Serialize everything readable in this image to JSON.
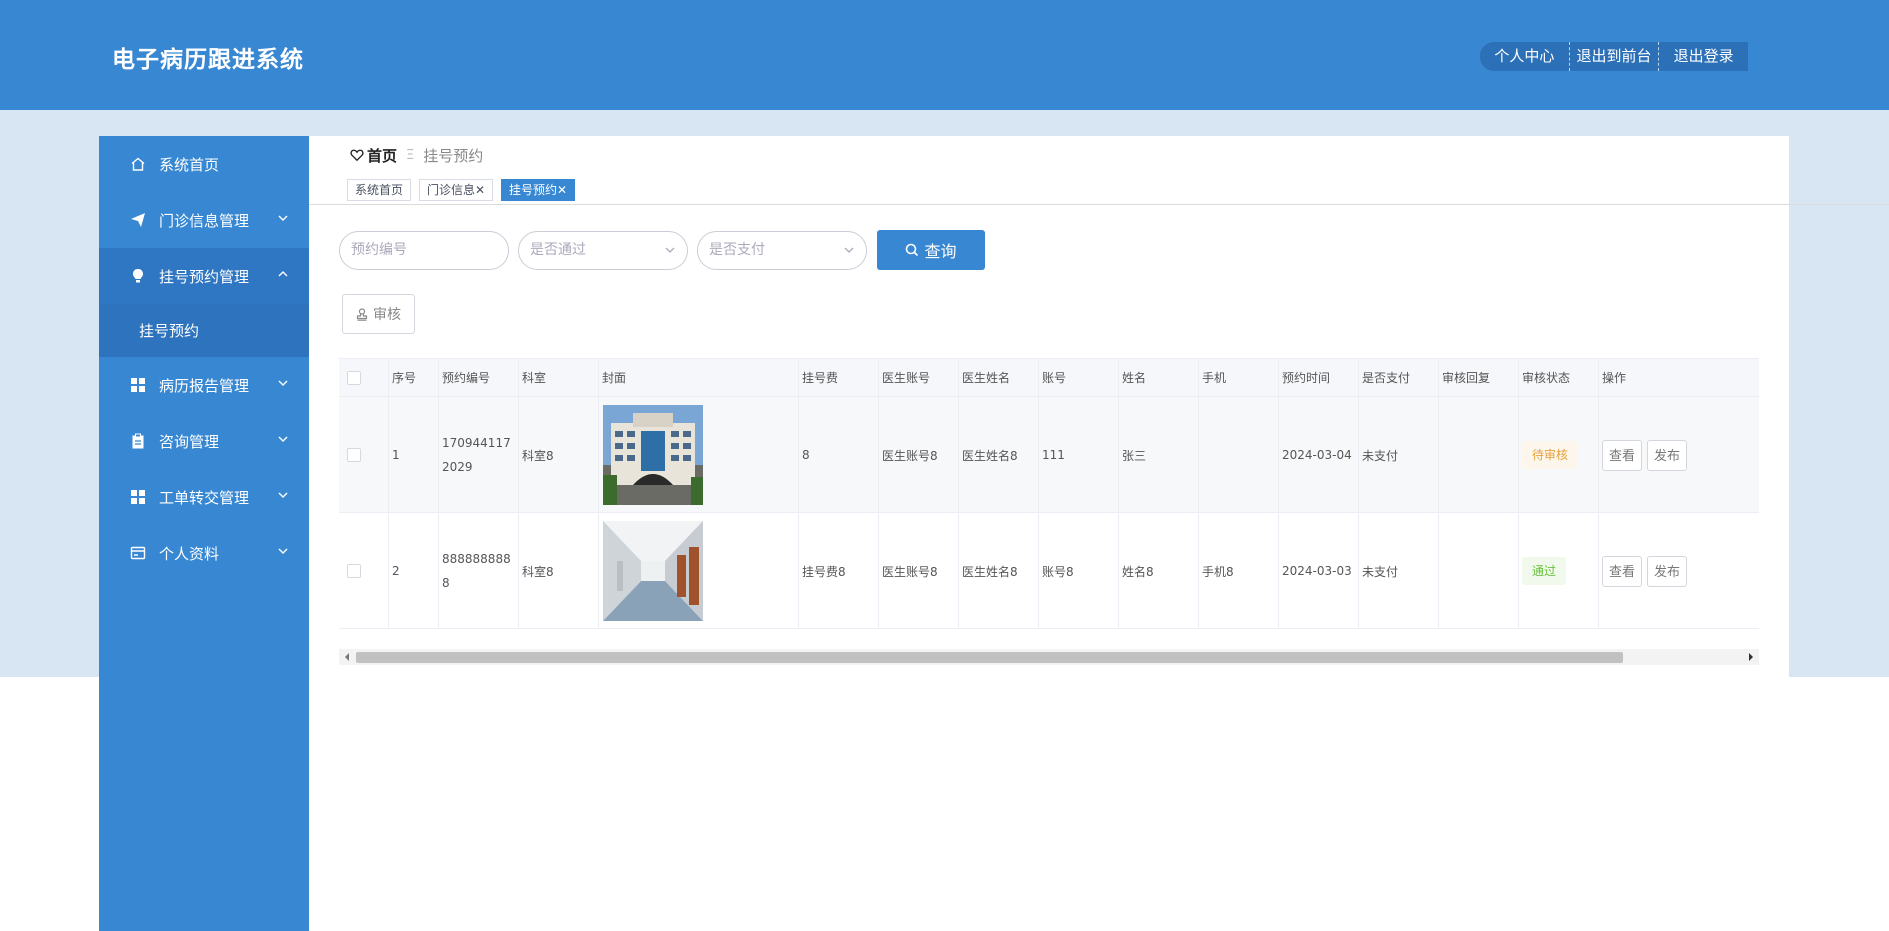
{
  "header": {
    "title": "电子病历跟进系统",
    "actions": [
      "个人中心",
      "退出到前台",
      "退出登录"
    ]
  },
  "sidebar": {
    "items": [
      {
        "label": "系统首页",
        "icon": "home-icon"
      },
      {
        "label": "门诊信息管理",
        "icon": "send-icon"
      },
      {
        "label": "挂号预约管理",
        "icon": "bulb-icon",
        "open": true
      },
      {
        "label": "病历报告管理",
        "icon": "grid-icon"
      },
      {
        "label": "咨询管理",
        "icon": "clipboard-icon"
      },
      {
        "label": "工单转交管理",
        "icon": "grid-icon"
      },
      {
        "label": "个人资料",
        "icon": "card-icon"
      }
    ],
    "sub_item": "挂号预约"
  },
  "breadcrumb": {
    "home": "首页",
    "current": "挂号预约"
  },
  "tags": [
    {
      "label": "系统首页"
    },
    {
      "label": "门诊信息",
      "closable": true
    },
    {
      "label": "挂号预约",
      "closable": true,
      "active": true
    }
  ],
  "search": {
    "booking_no_placeholder": "预约编号",
    "passed_placeholder": "是否通过",
    "paid_placeholder": "是否支付",
    "query_label": "查询"
  },
  "toolbar": {
    "audit_label": "审核"
  },
  "table": {
    "columns": [
      "序号",
      "预约编号",
      "科室",
      "封面",
      "挂号费",
      "医生账号",
      "医生姓名",
      "账号",
      "姓名",
      "手机",
      "预约时间",
      "是否支付",
      "审核回复",
      "审核状态",
      "操作"
    ],
    "rows": [
      {
        "index": "1",
        "booking_no": "1709441172029",
        "department": "科室8",
        "fee": "8",
        "doctor_account": "医生账号8",
        "doctor_name": "医生姓名8",
        "account": "111",
        "name": "张三",
        "phone": "",
        "time": "2024-03-04",
        "paid": "未支付",
        "reply": "",
        "status": "待审核",
        "status_type": "pending"
      },
      {
        "index": "2",
        "booking_no": "8888888888",
        "department": "科室8",
        "fee": "挂号费8",
        "doctor_account": "医生账号8",
        "doctor_name": "医生姓名8",
        "account": "账号8",
        "name": "姓名8",
        "phone": "手机8",
        "time": "2024-03-03",
        "paid": "未支付",
        "reply": "",
        "status": "通过",
        "status_type": "pass"
      }
    ],
    "actions": {
      "view": "查看",
      "publish": "发布"
    }
  },
  "colors": {
    "primary": "#3887d2",
    "pending": "#e6a23c",
    "pass": "#67c23a"
  }
}
